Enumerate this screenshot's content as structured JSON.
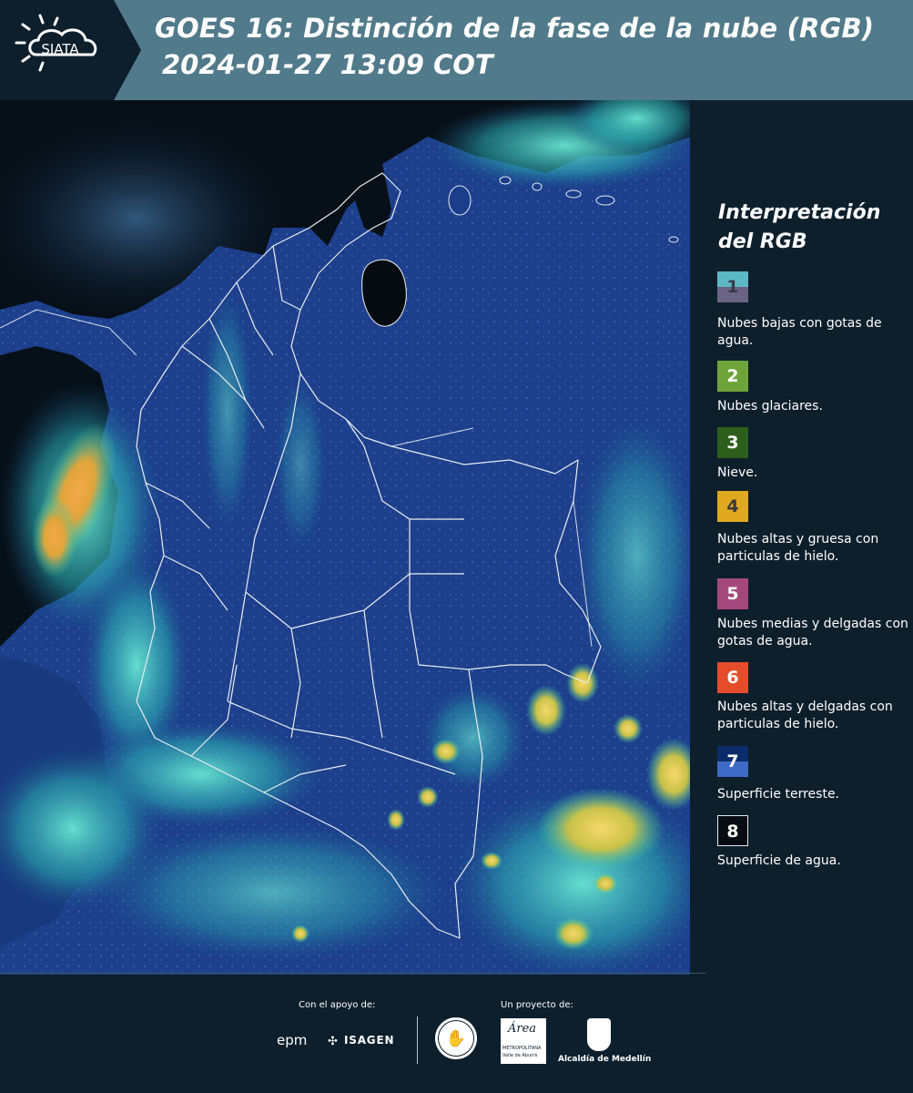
{
  "header": {
    "logo_text": "SIATA",
    "title_line1": "GOES 16: Distinción de la fase de la nube (RGB)",
    "title_line2": "2024-01-27 13:09 COT",
    "background_color": "#517a8a"
  },
  "legend": {
    "title_line1": "Interpretación",
    "title_line2": "del RGB",
    "items": [
      {
        "number": "1",
        "label": "Nubes bajas con gotas de agua.",
        "color": "#5db8c5 / #6b6383"
      },
      {
        "number": "2",
        "label": "Nubes glaciares.",
        "color": "#6fa43a"
      },
      {
        "number": "3",
        "label": "Nieve.",
        "color": "#2e5e1c"
      },
      {
        "number": "4",
        "label": "Nubes altas y gruesa con particulas de hielo.",
        "color": "#e1a822"
      },
      {
        "number": "5",
        "label": "Nubes medias y delgadas con gotas de agua.",
        "color": "#a4487c"
      },
      {
        "number": "6",
        "label": "Nubes altas y delgadas con particulas de hielo.",
        "color": "#e54d2a"
      },
      {
        "number": "7",
        "label": "Superficie terreste.",
        "color": "#0c2b6b / #3f6ac7"
      },
      {
        "number": "8",
        "label": "Superficie de agua.",
        "color": "#070d12"
      }
    ]
  },
  "footer": {
    "support_label": "Con el apoyo de:",
    "project_label": "Un proyecto de:",
    "sponsors": [
      "epm",
      "ISAGEN"
    ],
    "partners": [
      "Área Metropolitana Valle de Aburrá",
      "Alcaldía de Medellín"
    ],
    "partner_small_1": "METROPOLITANA",
    "partner_small_2": "Valle de Aburrá",
    "partner_script": "Área"
  },
  "map": {
    "description_colors": {
      "land": "#1b3d8a",
      "water": "#070d12",
      "low_cloud": "#4fd6c7",
      "high_cloud": "#e9a23b",
      "boundary": "#e8eef0"
    }
  }
}
